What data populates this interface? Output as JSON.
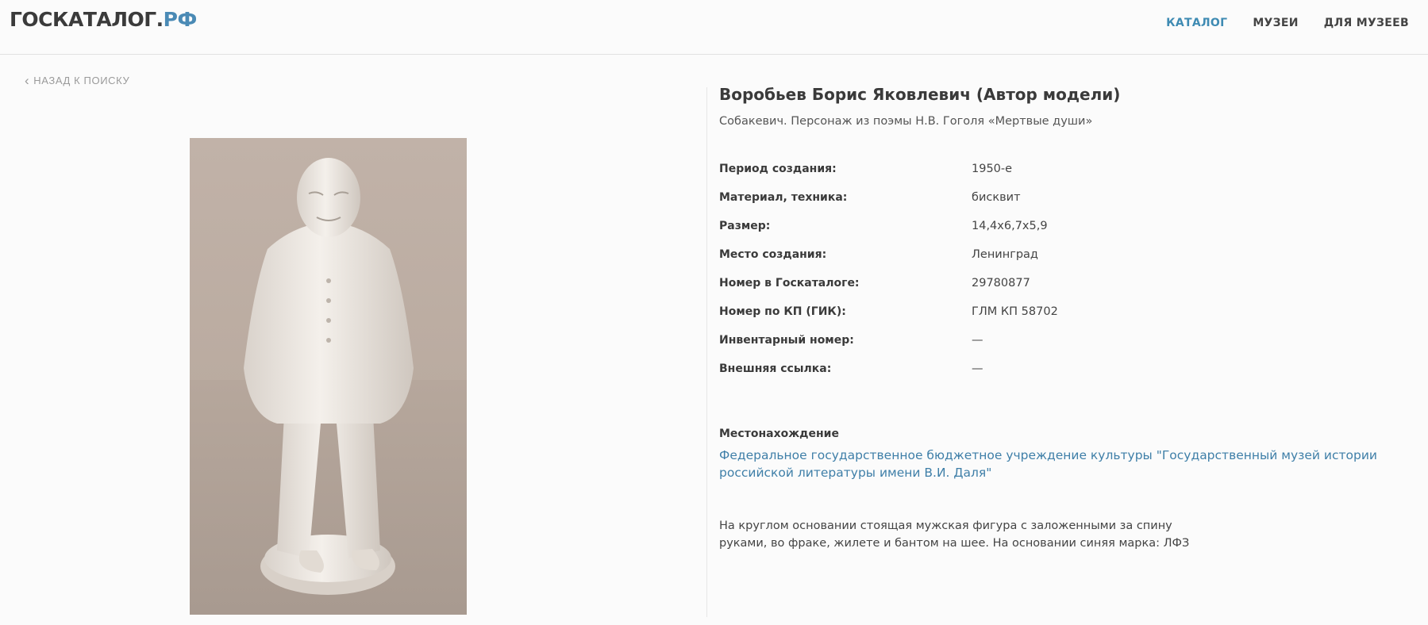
{
  "header": {
    "logo_main": "ГОСКАТАЛОГ.",
    "logo_suffix": "РФ",
    "nav": [
      {
        "label": "КАТАЛОГ",
        "active": true
      },
      {
        "label": "МУЗЕИ",
        "active": false
      },
      {
        "label": "ДЛЯ МУЗЕЕВ",
        "active": false
      }
    ]
  },
  "back_link": "НАЗАД К ПОИСКУ",
  "item": {
    "author": "Воробьев Борис Яковлевич (Автор модели)",
    "title": "Собакевич. Персонаж из поэмы Н.В. Гоголя «Мертвые души»",
    "properties": [
      {
        "label": "Период создания:",
        "value": "1950-е"
      },
      {
        "label": "Материал, техника:",
        "value": "бисквит"
      },
      {
        "label": "Размер:",
        "value": "14,4х6,7х5,9"
      },
      {
        "label": "Место создания:",
        "value": "Ленинград"
      },
      {
        "label": "Номер в Госкаталоге:",
        "value": "29780877"
      },
      {
        "label": "Номер по КП (ГИК):",
        "value": "ГЛМ КП 58702"
      },
      {
        "label": "Инвентарный номер:",
        "value": "—"
      },
      {
        "label": "Внешняя ссылка:",
        "value": "—"
      }
    ],
    "location_heading": "Местонахождение",
    "location_link": "Федеральное государственное бюджетное учреждение культуры \"Государственный музей истории российской литературы имени В.И. Даля\"",
    "description": "На круглом основании стоящая мужская фигура с заложенными за спину руками, во фраке, жилете и бантом на шее. На основании синяя марка: ЛФЗ"
  },
  "colors": {
    "accent": "#3f8bb3",
    "link": "#3f7fa8"
  }
}
